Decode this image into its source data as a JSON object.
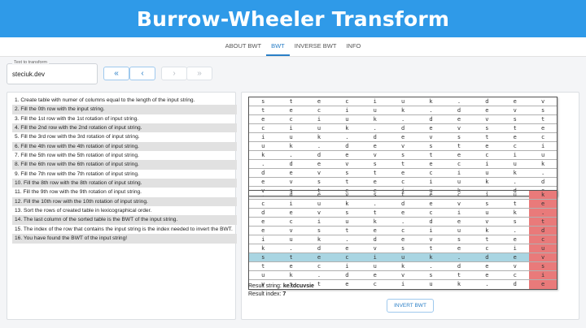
{
  "app": {
    "title": "Burrow-Wheeler Transform"
  },
  "tabs": [
    {
      "label": "ABOUT BWT",
      "active": false
    },
    {
      "label": "BWT",
      "active": true
    },
    {
      "label": "INVERSE BWT",
      "active": false
    },
    {
      "label": "INFO",
      "active": false
    }
  ],
  "input": {
    "legend": "Text to transform",
    "value": "steciuk.dev"
  },
  "nav_buttons": [
    {
      "icon": "double-chevron-left-icon",
      "glyph": "«",
      "enabled": true
    },
    {
      "icon": "chevron-left-icon",
      "glyph": "‹",
      "enabled": true
    },
    {
      "icon": "chevron-right-icon",
      "glyph": "›",
      "enabled": false
    },
    {
      "icon": "double-chevron-right-icon",
      "glyph": "»",
      "enabled": false
    }
  ],
  "steps": [
    "1. Create table with numer of columns equal to the length of the input string.",
    "2. Fill the 0th row with the input string.",
    "3. Fill the 1st row with the 1st rotation of input string.",
    "4. Fill the 2nd row with the 2nd rotation of input string.",
    "5. Fill the 3rd row with the 3rd rotation of input string.",
    "6. Fill the 4th row with the 4th rotation of input string.",
    "7. Fill the 5th row with the 5th rotation of input string.",
    "8. Fill the 6th row with the 6th rotation of input string.",
    "9. Fill the 7th row with the 7th rotation of input string.",
    "10. Fill the 8th row with the 8th rotation of input string.",
    "11. Fill the 9th row with the 9th rotation of input string.",
    "12. Fill the 10th row with the 10th rotation of input string.",
    "13. Sort the rows of created table in lexicographical order.",
    "14. The last column of the sorted table is the BWT of the input string.",
    "15. The index of the row that contains the input string is the index needed to invert the BWT.",
    "16. You have found the BWT of the input string!"
  ],
  "rotations": [
    [
      "s",
      "t",
      "e",
      "c",
      "i",
      "u",
      "k",
      ".",
      "d",
      "e",
      "v"
    ],
    [
      "t",
      "e",
      "c",
      "i",
      "u",
      "k",
      ".",
      "d",
      "e",
      "v",
      "s"
    ],
    [
      "e",
      "c",
      "i",
      "u",
      "k",
      ".",
      "d",
      "e",
      "v",
      "s",
      "t"
    ],
    [
      "c",
      "i",
      "u",
      "k",
      ".",
      "d",
      "e",
      "v",
      "s",
      "t",
      "e"
    ],
    [
      "i",
      "u",
      "k",
      ".",
      "d",
      "e",
      "v",
      "s",
      "t",
      "e",
      "c"
    ],
    [
      "u",
      "k",
      ".",
      "d",
      "e",
      "v",
      "s",
      "t",
      "e",
      "c",
      "i"
    ],
    [
      "k",
      ".",
      "d",
      "e",
      "v",
      "s",
      "t",
      "e",
      "c",
      "i",
      "u"
    ],
    [
      ".",
      "d",
      "e",
      "v",
      "s",
      "t",
      "e",
      "c",
      "i",
      "u",
      "k"
    ],
    [
      "d",
      "e",
      "v",
      "s",
      "t",
      "e",
      "c",
      "i",
      "u",
      "k",
      "."
    ],
    [
      "e",
      "v",
      "s",
      "t",
      "e",
      "c",
      "i",
      "u",
      "k",
      ".",
      "d"
    ],
    [
      "v",
      "s",
      "t",
      "e",
      "c",
      "i",
      "u",
      "k",
      ".",
      "d",
      "e"
    ]
  ],
  "sorted": [
    [
      ".",
      "d",
      "e",
      "v",
      "s",
      "t",
      "e",
      "c",
      "i",
      "u",
      "k"
    ],
    [
      "c",
      "i",
      "u",
      "k",
      ".",
      "d",
      "e",
      "v",
      "s",
      "t",
      "e"
    ],
    [
      "d",
      "e",
      "v",
      "s",
      "t",
      "e",
      "c",
      "i",
      "u",
      "k",
      "."
    ],
    [
      "e",
      "c",
      "i",
      "u",
      "k",
      ".",
      "d",
      "e",
      "v",
      "s",
      "t"
    ],
    [
      "e",
      "v",
      "s",
      "t",
      "e",
      "c",
      "i",
      "u",
      "k",
      ".",
      "d"
    ],
    [
      "i",
      "u",
      "k",
      ".",
      "d",
      "e",
      "v",
      "s",
      "t",
      "e",
      "c"
    ],
    [
      "k",
      ".",
      "d",
      "e",
      "v",
      "s",
      "t",
      "e",
      "c",
      "i",
      "u"
    ],
    [
      "s",
      "t",
      "e",
      "c",
      "i",
      "u",
      "k",
      ".",
      "d",
      "e",
      "v"
    ],
    [
      "t",
      "e",
      "c",
      "i",
      "u",
      "k",
      ".",
      "d",
      "e",
      "v",
      "s"
    ],
    [
      "u",
      "k",
      ".",
      "d",
      "e",
      "v",
      "s",
      "t",
      "e",
      "c",
      "i"
    ],
    [
      "v",
      "s",
      "t",
      "e",
      "c",
      "i",
      "u",
      "k",
      ".",
      "d",
      "e"
    ]
  ],
  "selected_sorted_row": 7,
  "colors": {
    "last_column": "#e97a7a",
    "selected_row": "#a9d5e2",
    "accent": "#2f9ae8"
  },
  "result": {
    "string_label": "Result string:",
    "string_value": "ke.tdcuvsie",
    "index_label": "Result index:",
    "index_value": "7"
  },
  "invert_button": {
    "label": "INVERT BWT"
  }
}
